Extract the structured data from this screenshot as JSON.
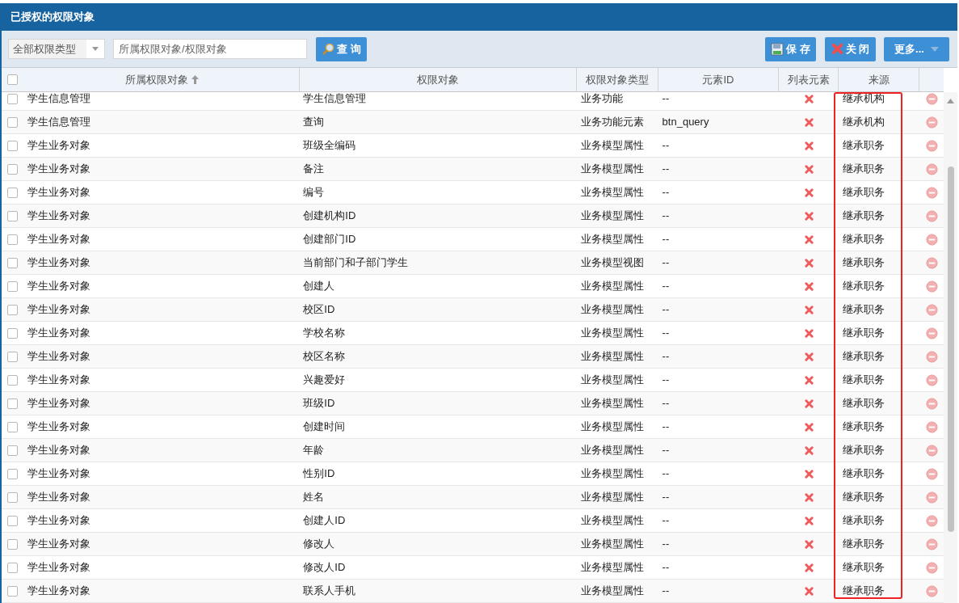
{
  "panel": {
    "title": "已授权的权限对象"
  },
  "toolbar": {
    "type_select": {
      "value": "全部权限类型"
    },
    "search": {
      "placeholder": "所属权限对象/权限对象"
    },
    "query_button": "查 询",
    "buttons": [
      {
        "kind": "save",
        "label": "保 存"
      },
      {
        "kind": "close",
        "label": "关 闭"
      },
      {
        "kind": "more",
        "label": "更多..."
      }
    ]
  },
  "table": {
    "select_all_checked": false,
    "columns": [
      {
        "label": "所属权限对象",
        "sorted_ascending": true
      },
      {
        "label": "权限对象",
        "sorted_ascending": false
      },
      {
        "label": "权限对象类型",
        "sorted_ascending": false
      },
      {
        "label": "元素ID",
        "sorted_ascending": false
      },
      {
        "label": "列表元素",
        "sorted_ascending": false
      },
      {
        "label": "来源",
        "sorted_ascending": false
      }
    ],
    "rows": [
      {
        "checked": false,
        "owner": "学生信息管理",
        "object": "学生信息管理",
        "type": "业务功能",
        "element_id": "--",
        "list_element": false,
        "source": "继承机构"
      },
      {
        "checked": false,
        "owner": "学生信息管理",
        "object": "查询",
        "type": "业务功能元素",
        "element_id": "btn_query",
        "list_element": false,
        "source": "继承机构"
      },
      {
        "checked": false,
        "owner": "学生业务对象",
        "object": "班级全编码",
        "type": "业务模型属性",
        "element_id": "--",
        "list_element": false,
        "source": "继承职务"
      },
      {
        "checked": false,
        "owner": "学生业务对象",
        "object": "备注",
        "type": "业务模型属性",
        "element_id": "--",
        "list_element": false,
        "source": "继承职务"
      },
      {
        "checked": false,
        "owner": "学生业务对象",
        "object": "编号",
        "type": "业务模型属性",
        "element_id": "--",
        "list_element": false,
        "source": "继承职务"
      },
      {
        "checked": false,
        "owner": "学生业务对象",
        "object": "创建机构ID",
        "type": "业务模型属性",
        "element_id": "--",
        "list_element": false,
        "source": "继承职务"
      },
      {
        "checked": false,
        "owner": "学生业务对象",
        "object": "创建部门ID",
        "type": "业务模型属性",
        "element_id": "--",
        "list_element": false,
        "source": "继承职务"
      },
      {
        "checked": false,
        "owner": "学生业务对象",
        "object": "当前部门和子部门学生",
        "type": "业务模型视图",
        "element_id": "--",
        "list_element": false,
        "source": "继承职务"
      },
      {
        "checked": false,
        "owner": "学生业务对象",
        "object": "创建人",
        "type": "业务模型属性",
        "element_id": "--",
        "list_element": false,
        "source": "继承职务"
      },
      {
        "checked": false,
        "owner": "学生业务对象",
        "object": "校区ID",
        "type": "业务模型属性",
        "element_id": "--",
        "list_element": false,
        "source": "继承职务"
      },
      {
        "checked": false,
        "owner": "学生业务对象",
        "object": "学校名称",
        "type": "业务模型属性",
        "element_id": "--",
        "list_element": false,
        "source": "继承职务"
      },
      {
        "checked": false,
        "owner": "学生业务对象",
        "object": "校区名称",
        "type": "业务模型属性",
        "element_id": "--",
        "list_element": false,
        "source": "继承职务"
      },
      {
        "checked": false,
        "owner": "学生业务对象",
        "object": "兴趣爱好",
        "type": "业务模型属性",
        "element_id": "--",
        "list_element": false,
        "source": "继承职务"
      },
      {
        "checked": false,
        "owner": "学生业务对象",
        "object": "班级ID",
        "type": "业务模型属性",
        "element_id": "--",
        "list_element": false,
        "source": "继承职务"
      },
      {
        "checked": false,
        "owner": "学生业务对象",
        "object": "创建时间",
        "type": "业务模型属性",
        "element_id": "--",
        "list_element": false,
        "source": "继承职务"
      },
      {
        "checked": false,
        "owner": "学生业务对象",
        "object": "年龄",
        "type": "业务模型属性",
        "element_id": "--",
        "list_element": false,
        "source": "继承职务"
      },
      {
        "checked": false,
        "owner": "学生业务对象",
        "object": "性别ID",
        "type": "业务模型属性",
        "element_id": "--",
        "list_element": false,
        "source": "继承职务"
      },
      {
        "checked": false,
        "owner": "学生业务对象",
        "object": "姓名",
        "type": "业务模型属性",
        "element_id": "--",
        "list_element": false,
        "source": "继承职务"
      },
      {
        "checked": false,
        "owner": "学生业务对象",
        "object": "创建人ID",
        "type": "业务模型属性",
        "element_id": "--",
        "list_element": false,
        "source": "继承职务"
      },
      {
        "checked": false,
        "owner": "学生业务对象",
        "object": "修改人",
        "type": "业务模型属性",
        "element_id": "--",
        "list_element": false,
        "source": "继承职务"
      },
      {
        "checked": false,
        "owner": "学生业务对象",
        "object": "修改人ID",
        "type": "业务模型属性",
        "element_id": "--",
        "list_element": false,
        "source": "继承职务"
      },
      {
        "checked": false,
        "owner": "学生业务对象",
        "object": "联系人手机",
        "type": "业务模型属性",
        "element_id": "--",
        "list_element": false,
        "source": "继承职务"
      }
    ]
  }
}
